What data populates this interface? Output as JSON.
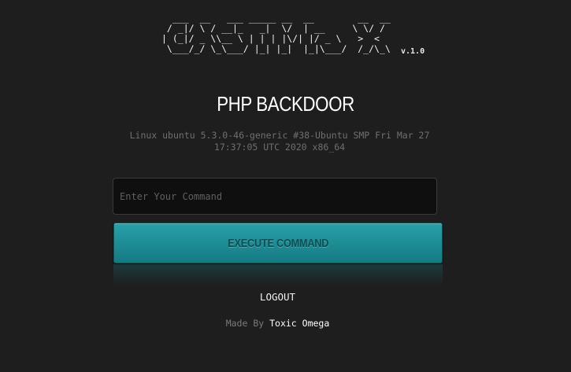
{
  "header": {
    "logo_ascii": "  ___  __   ___ _____ __  __        __  __\n / _|/ \\ / __|_   _|  \\/  | __     \\ \\/ /\n| (_|/ _ \\\\__ \\ | | | |\\/| |/ _ \\   >  <\n \\___/_/ \\_\\___/ |_| |_|  |_|\\___/  /_/\\_\\",
    "version": "v.1.0"
  },
  "main": {
    "title": "PHP BACKDOOR",
    "system_info": "Linux ubuntu 5.3.0-46-generic #38-Ubuntu SMP Fri Mar 27 17:37:05 UTC 2020 x86_64",
    "command_input": {
      "value": "",
      "placeholder": "Enter Your Command"
    },
    "execute_label": "EXECUTE COMMAND",
    "logout_label": "LOGOUT"
  },
  "footer": {
    "made_by_label": "Made By",
    "author": "Toxic Omega"
  },
  "colors": {
    "background": "#1e1e1e",
    "button_teal": "#1f8f97",
    "button_text": "#0f4e53",
    "muted_text": "#6f6f6f"
  }
}
